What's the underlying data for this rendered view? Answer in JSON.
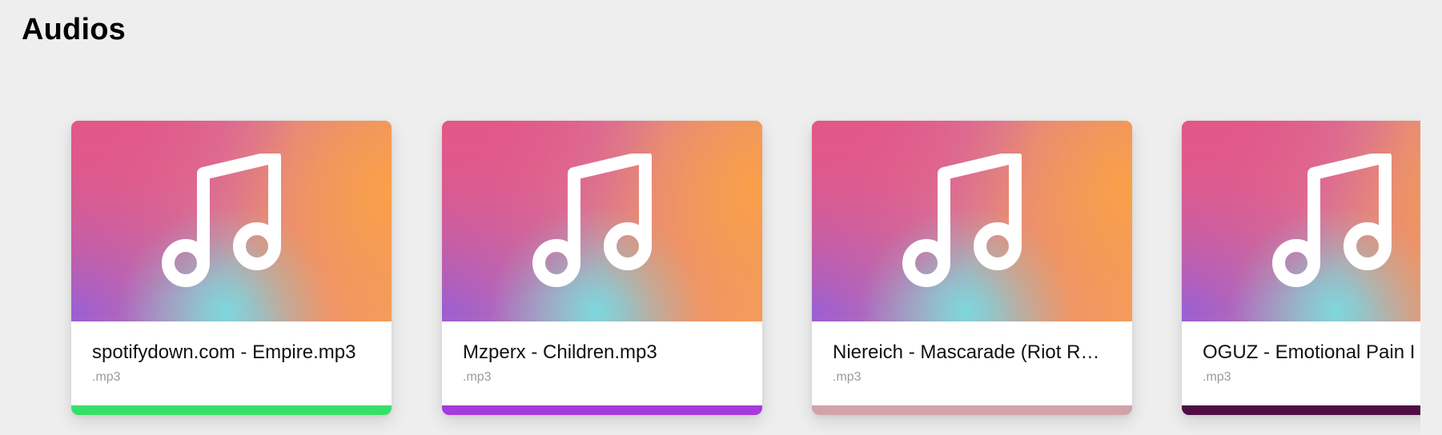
{
  "page": {
    "title": "Audios"
  },
  "cards": [
    {
      "title": "spotifydown.com - Empire.mp3",
      "ext": ".mp3",
      "bar_color": "#37df6a",
      "icon": "music-note-icon"
    },
    {
      "title": "Mzperx - Children.mp3",
      "ext": ".mp3",
      "bar_color": "#a73adb",
      "icon": "music-note-icon"
    },
    {
      "title": "Niereich - Mascarade (Riot R…",
      "ext": ".mp3",
      "bar_color": "#d1a4aa",
      "icon": "music-note-icon"
    },
    {
      "title": "OGUZ - Emotional Pain I",
      "ext": ".mp3",
      "bar_color": "#4e0e45",
      "icon": "music-note-icon"
    }
  ]
}
